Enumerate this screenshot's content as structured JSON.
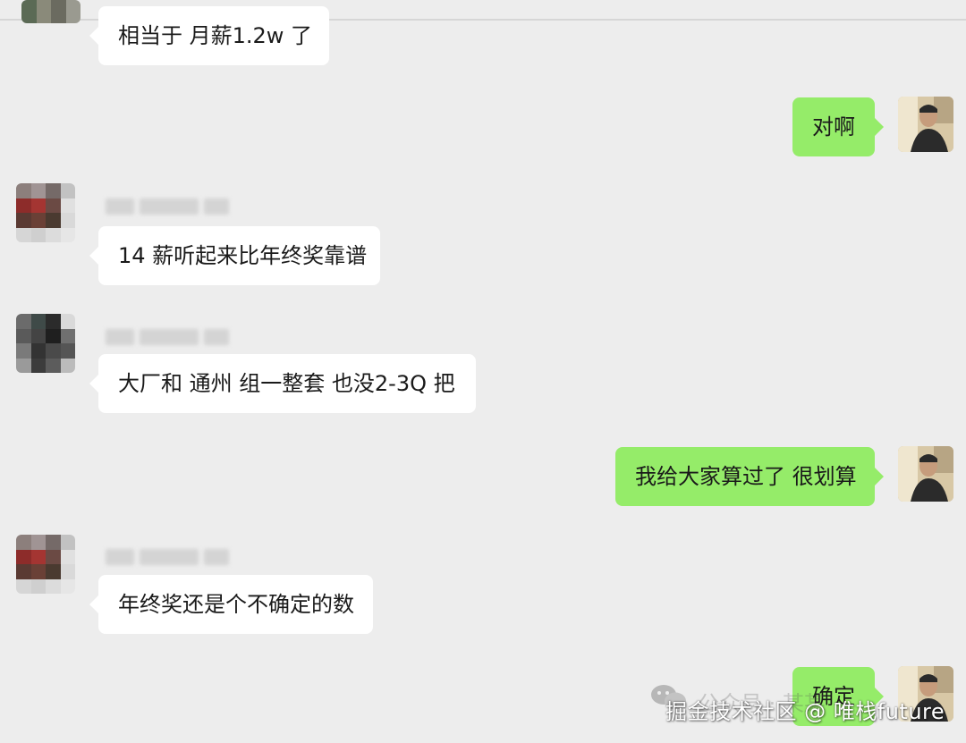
{
  "chat": {
    "messages": [
      {
        "side": "in",
        "text": "相当于 月薪1.2w 了"
      },
      {
        "side": "out",
        "text": "对啊"
      },
      {
        "side": "in",
        "text": "14 薪听起来比年终奖靠谱"
      },
      {
        "side": "in",
        "text": "大厂和 通州 组一整套 也没2-3Q 把"
      },
      {
        "side": "out",
        "text": "我给大家算过了 很划算"
      },
      {
        "side": "in",
        "text": "年终奖还是个不确定的数"
      },
      {
        "side": "out",
        "text": "确定"
      }
    ]
  },
  "watermark": {
    "faded": "公众号 · 某某 · ",
    "text": "掘金技术社区 @ 唯栈future",
    "icon": "wechat-icon"
  },
  "colors": {
    "background": "#ededed",
    "incoming_bubble": "#ffffff",
    "outgoing_bubble": "#95ec69",
    "text": "#1a1a1a"
  }
}
